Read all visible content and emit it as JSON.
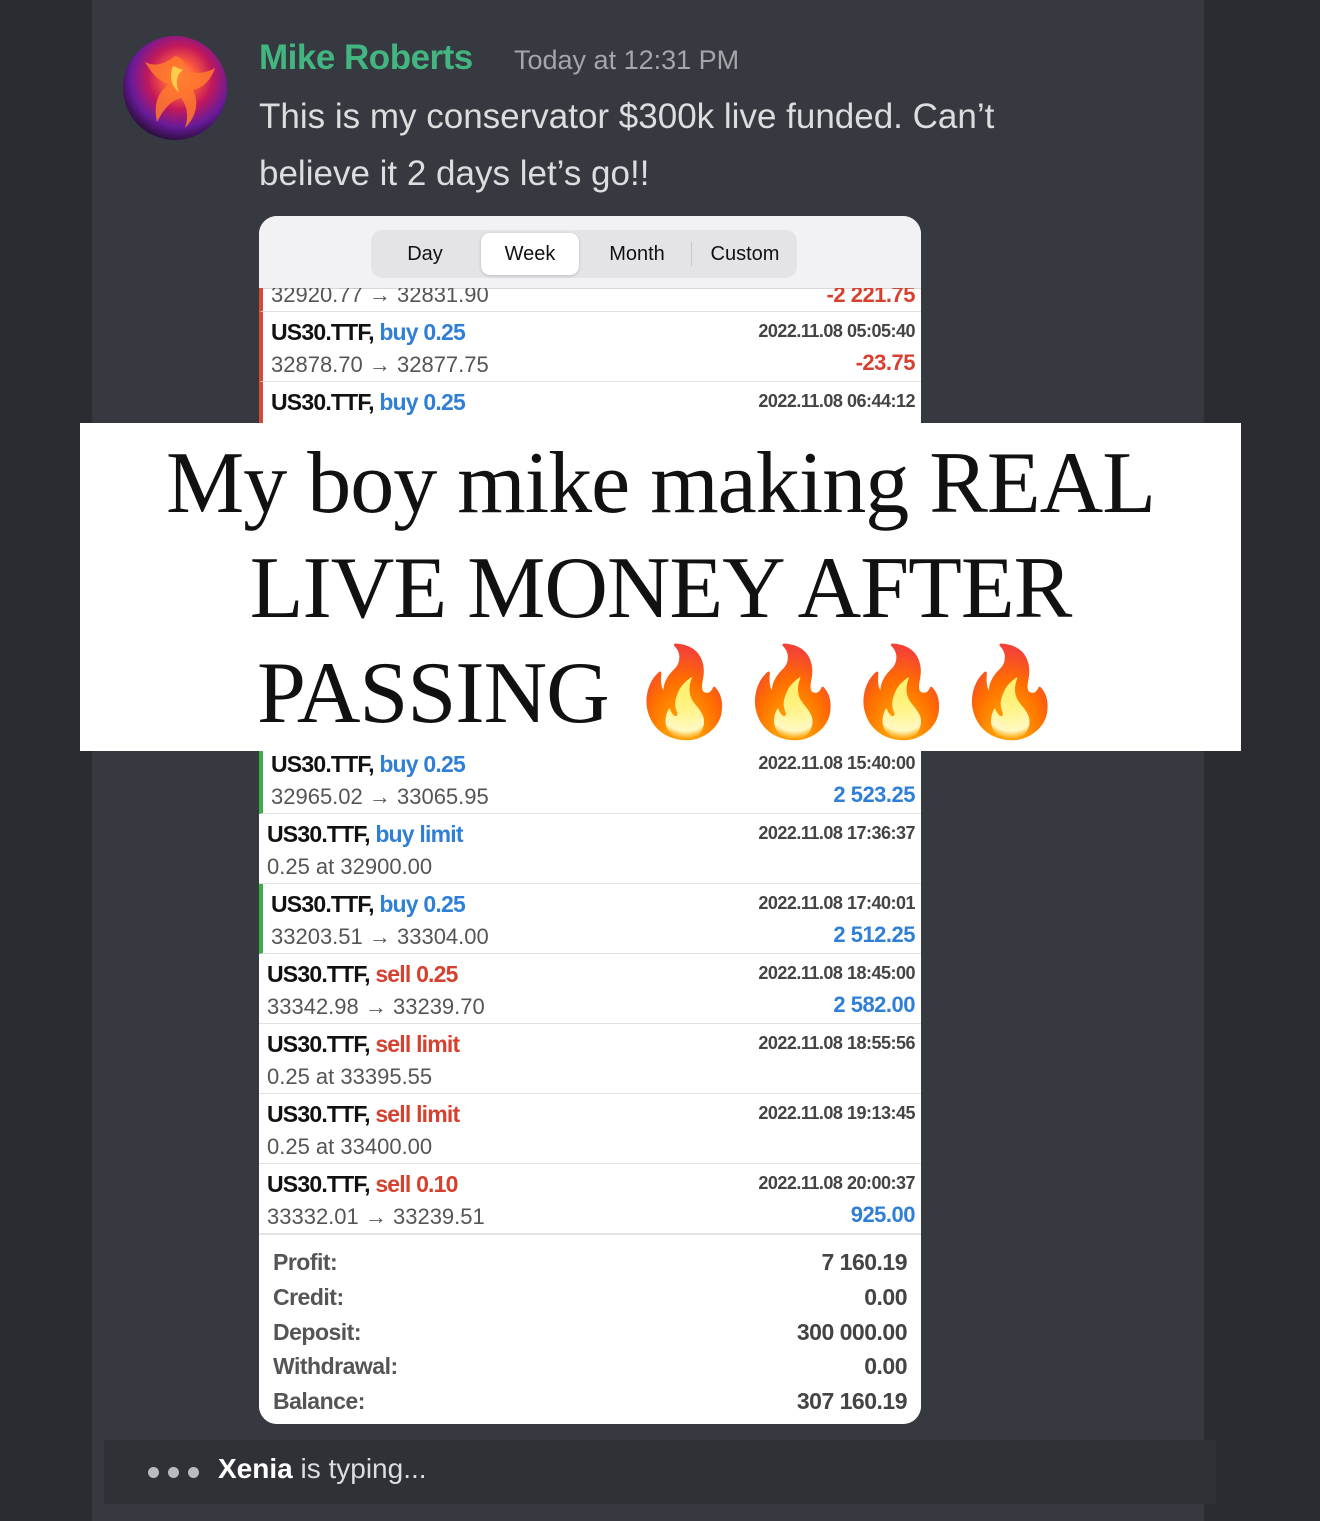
{
  "message": {
    "author": "Mike Roberts",
    "timestamp": "Today at 12:31 PM",
    "text_line1": "This is my conservator $300k live funded. Can’t",
    "text_line2": "believe it 2 days let’s go!!"
  },
  "screenshot": {
    "tabs": [
      "Day",
      "Week",
      "Month",
      "Custom"
    ],
    "active_tab": "Week",
    "partial_row": {
      "prices": "32920.77 → 32831.90",
      "profit": "-2 221.75"
    },
    "rows_top": [
      {
        "symbol": "US30.TTF,",
        "type": "buy 0.25",
        "prices": "32878.70 → 32877.75",
        "date": "2022.11.08 05:05:40",
        "profit": "-23.75"
      },
      {
        "symbol": "US30.TTF,",
        "type": "buy 0.25",
        "prices": "",
        "date": "2022.11.08 06:44:12",
        "profit": ""
      }
    ],
    "rows_bottom": [
      {
        "symbol": "US30.TTF,",
        "type": "buy 0.25",
        "prices": "32965.02 → 33065.95",
        "date": "2022.11.08 15:40:00",
        "profit": "2 523.25"
      },
      {
        "symbol": "US30.TTF,",
        "type": "buy limit",
        "prices": "0.25 at 32900.00",
        "date": "2022.11.08 17:36:37",
        "profit": ""
      },
      {
        "symbol": "US30.TTF,",
        "type": "buy 0.25",
        "prices": "33203.51 → 33304.00",
        "date": "2022.11.08 17:40:01",
        "profit": "2 512.25"
      },
      {
        "symbol": "US30.TTF,",
        "type": "sell 0.25",
        "prices": "33342.98 → 33239.70",
        "date": "2022.11.08 18:45:00",
        "profit": "2 582.00"
      },
      {
        "symbol": "US30.TTF,",
        "type": "sell limit",
        "prices": "0.25 at 33395.55",
        "date": "2022.11.08 18:55:56",
        "profit": ""
      },
      {
        "symbol": "US30.TTF,",
        "type": "sell limit",
        "prices": "0.25 at 33400.00",
        "date": "2022.11.08 19:13:45",
        "profit": ""
      },
      {
        "symbol": "US30.TTF,",
        "type": "sell 0.10",
        "prices": "33332.01 → 33239.51",
        "date": "2022.11.08 20:00:37",
        "profit": "925.00"
      }
    ],
    "summary": {
      "profit_label": "Profit:",
      "profit": "7 160.19",
      "credit_label": "Credit:",
      "credit": "0.00",
      "deposit_label": "Deposit:",
      "deposit": "300 000.00",
      "withdrawal_label": "Withdrawal:",
      "withdrawal": "0.00",
      "balance_label": "Balance:",
      "balance": "307 160.19"
    }
  },
  "caption": {
    "line1": "My boy mike making REAL",
    "line2": "LIVE MONEY AFTER",
    "line3": "PASSING 🔥🔥🔥🔥"
  },
  "typing": {
    "name": "Xenia",
    "suffix": " is typing..."
  },
  "colors": {
    "username": "#43b581",
    "buy": "#2f7fd6",
    "sell": "#d6402f",
    "panel": "#36393f"
  }
}
